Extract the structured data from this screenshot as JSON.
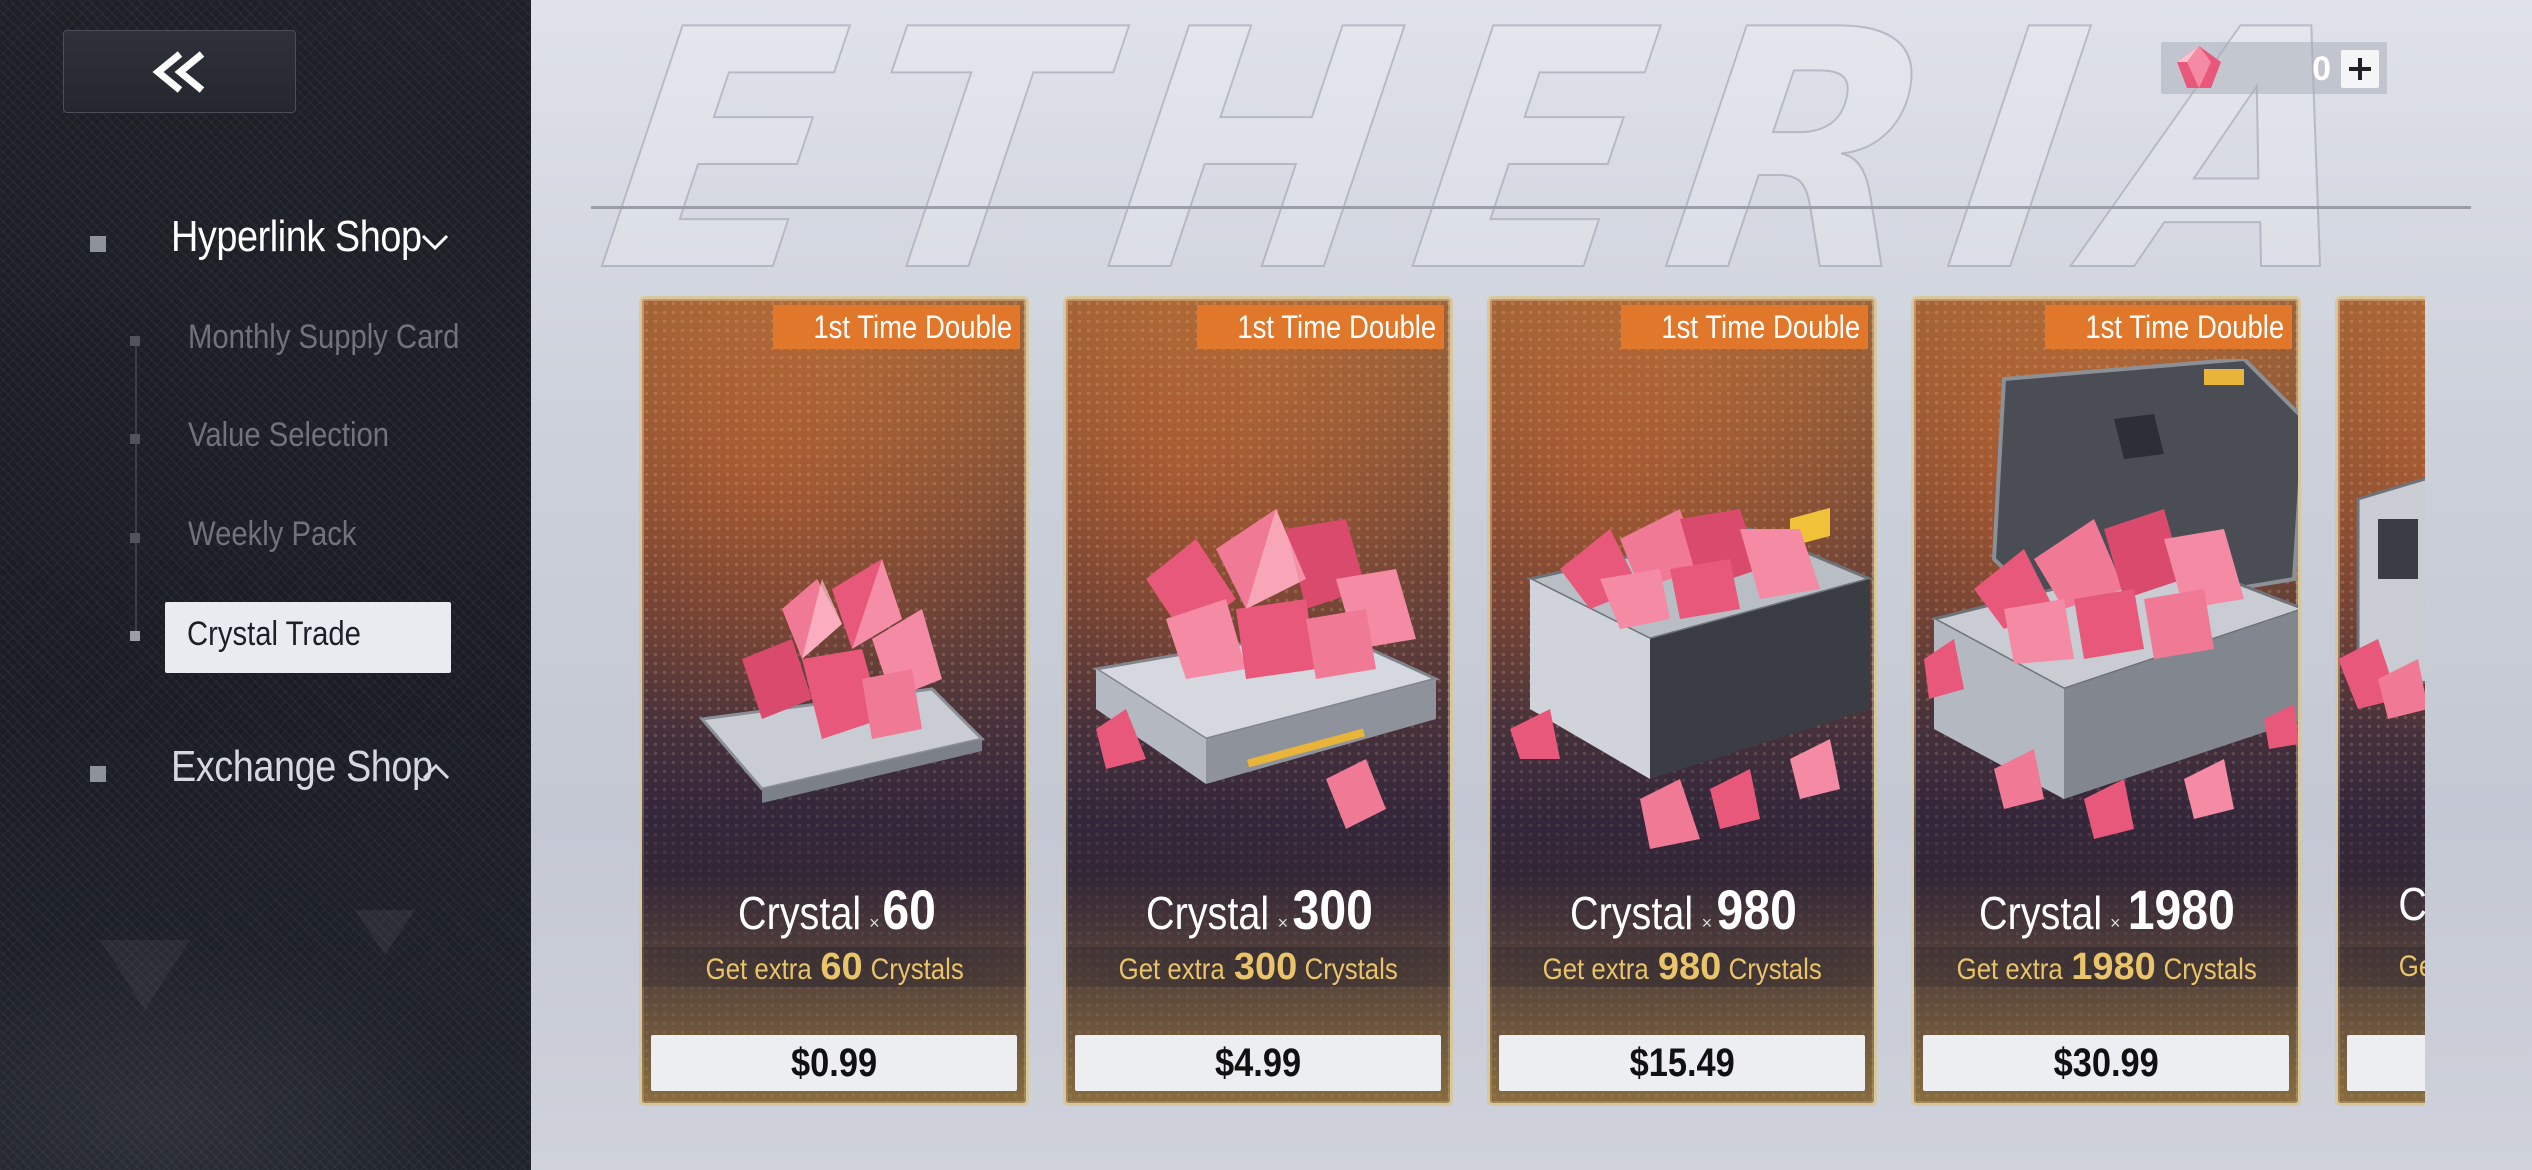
{
  "sidebar": {
    "back_icon": "double-chevron-left-icon",
    "sections": [
      {
        "label": "Hyperlink Shop",
        "expanded": true,
        "items": [
          "Monthly Supply Card",
          "Value Selection",
          "Weekly Pack",
          "Crystal Trade"
        ],
        "active_item": "Crystal Trade"
      },
      {
        "label": "Exchange Shop",
        "expanded": false
      }
    ]
  },
  "header": {
    "background_word": "ETHERIA",
    "currency": {
      "icon": "crystal-gem-icon",
      "amount": "0",
      "add_icon": "plus-icon"
    }
  },
  "cards": [
    {
      "badge": "1st Time Double",
      "name": "Crystal",
      "mult": "×",
      "qty": "60",
      "extra_prefix": "Get extra ",
      "extra_qty": "60",
      "extra_suffix": "Crystals",
      "price": "$0.99"
    },
    {
      "badge": "1st Time Double",
      "name": "Crystal",
      "mult": "×",
      "qty": "300",
      "extra_prefix": "Get extra ",
      "extra_qty": "300",
      "extra_suffix": "Crystals",
      "price": "$4.99"
    },
    {
      "badge": "1st Time Double",
      "name": "Crystal",
      "mult": "×",
      "qty": "980",
      "extra_prefix": "Get extra ",
      "extra_qty": "980",
      "extra_suffix": "Crystals",
      "price": "$15.49"
    },
    {
      "badge": "1st Time Double",
      "name": "Crystal",
      "mult": "×",
      "qty": "1980",
      "extra_prefix": "Get extra ",
      "extra_qty": "1980",
      "extra_suffix": "Crystals",
      "price": "$30.99"
    },
    {
      "name": "C",
      "extra_prefix": "Ge"
    }
  ],
  "colors": {
    "badge": "#e0772a",
    "extra_text": "#e9c46a",
    "card_border": "#d8c79a",
    "crystal": "#e8587a"
  }
}
